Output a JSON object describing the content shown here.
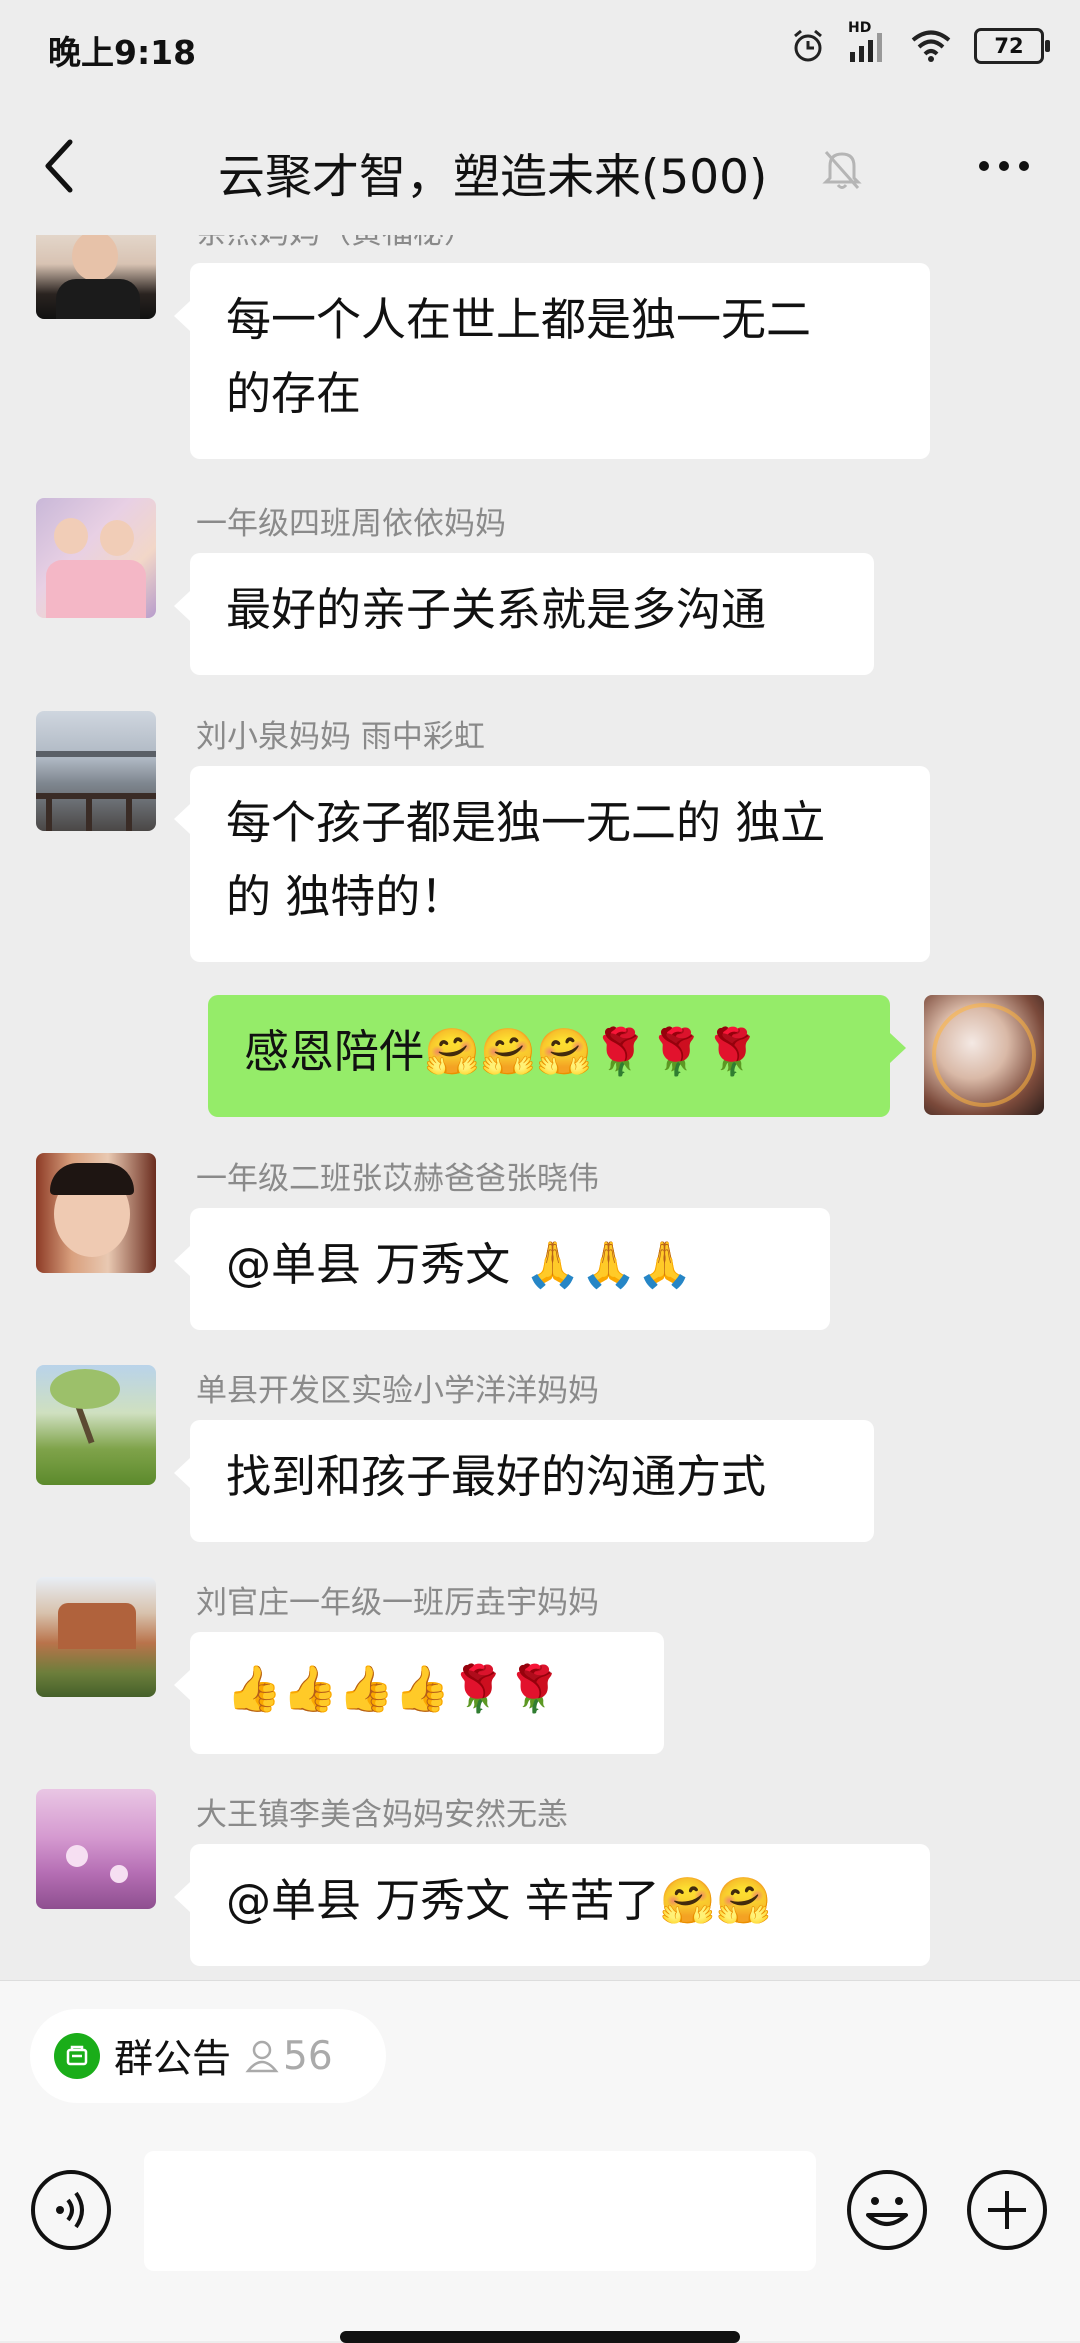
{
  "status_bar": {
    "time": "晚上9:18",
    "battery": "72",
    "network": "HD"
  },
  "nav": {
    "title": "云聚才智，塑造未来(500)"
  },
  "messages": [
    {
      "sender": "亲然妈妈（黄福秘）",
      "text_lines": [
        "每一个人在世上都是独一无二",
        "的存在"
      ]
    },
    {
      "sender": "一年级四班周依依妈妈",
      "text_lines": [
        "最好的亲子关系就是多沟通"
      ]
    },
    {
      "sender": "刘小泉妈妈  雨中彩虹",
      "text_lines": [
        "每个孩子都是独一无二的 独立",
        "的 独特的！"
      ]
    },
    {
      "sender": "",
      "text_lines": [
        "感恩陪伴🤗🤗🤗🌹🌹🌹"
      ],
      "self": true
    },
    {
      "sender": "一年级二班张苡赫爸爸张晓伟",
      "text_lines": [
        "@单县   万秀文  🙏🙏🙏"
      ]
    },
    {
      "sender": "单县开发区实验小学洋洋妈妈",
      "text_lines": [
        "找到和孩子最好的沟通方式"
      ]
    },
    {
      "sender": "刘官庄一年级一班厉垚宇妈妈",
      "text_lines": [
        "👍👍👍👍🌹🌹"
      ]
    },
    {
      "sender": "大王镇李美含妈妈安然无恙",
      "text_lines": [
        "@单县   万秀文  辛苦了🤗🤗"
      ]
    }
  ],
  "bottom": {
    "notice_label": "群公告",
    "member_count": "56"
  },
  "colors": {
    "self_bubble": "#95ec69",
    "notice_icon": "#1aad19",
    "background": "#ededed"
  }
}
